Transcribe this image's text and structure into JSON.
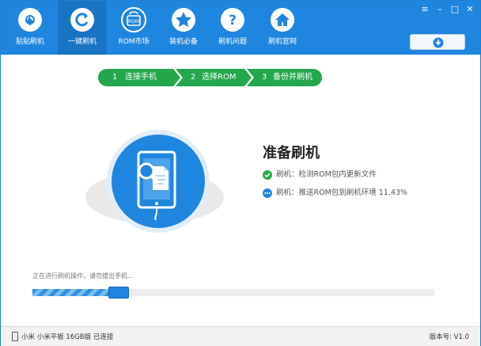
{
  "nav": {
    "items": [
      {
        "label": "贴贴刷机",
        "icon": "logo-icon",
        "active": false
      },
      {
        "label": "一键刷机",
        "icon": "refresh-icon",
        "active": true
      },
      {
        "label": "ROM市场",
        "icon": "rom-bag-icon",
        "active": false
      },
      {
        "label": "装机必备",
        "icon": "star-icon",
        "active": false
      },
      {
        "label": "刷机问题",
        "icon": "question-icon",
        "active": false
      },
      {
        "label": "刷机官网",
        "icon": "home-icon",
        "active": false
      }
    ]
  },
  "window_controls": [
    "menu-icon",
    "minimize-icon",
    "maximize-icon",
    "close-icon"
  ],
  "download_button": {
    "icon": "download-icon"
  },
  "steps": [
    {
      "number": "1",
      "label": "连接手机"
    },
    {
      "number": "2",
      "label": "选择ROM"
    },
    {
      "number": "3",
      "label": "备份并刷机"
    }
  ],
  "status": {
    "title": "准备刷机",
    "items": [
      {
        "text": "刷机：检测ROM包内更新文件",
        "state": "done",
        "icon": "check-circle-icon"
      },
      {
        "text": "刷机：推送ROM包到刷机环境 11.43%",
        "state": "in-progress",
        "icon": "dots-circle-icon"
      }
    ]
  },
  "progress": {
    "label": "正在进行刷机操作，请勿拔出手机...",
    "fraction": 0.24
  },
  "bottom": {
    "device": "小米 小米平板 16GB版 已连接",
    "version": "版本号: V1.0"
  },
  "colors": {
    "primary": "#1f86df",
    "step_green": "#23a74a",
    "done_green": "#2aa84a",
    "progress_blue": "#2f8fe0"
  }
}
